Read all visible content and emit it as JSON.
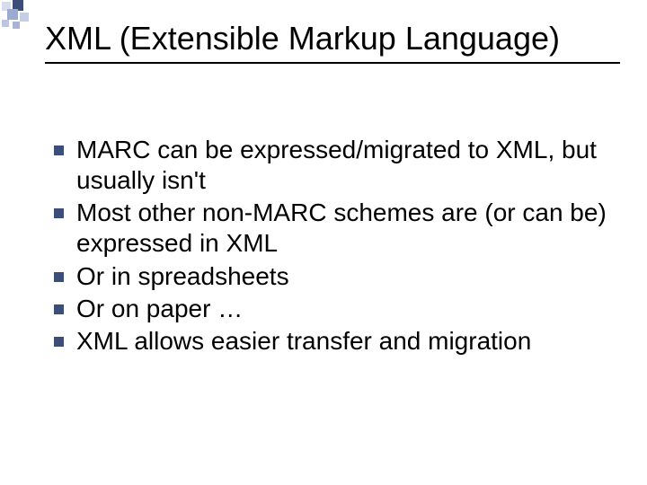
{
  "title": "XML (Extensible Markup Language)",
  "bullets": {
    "b0": "MARC can be expressed/migrated to XML, but usually isn't",
    "b1": "Most other non-MARC schemes are (or can be) expressed in XML",
    "b2": "Or in spreadsheets",
    "b3": "Or on paper …",
    "b4": "XML allows easier transfer and migration"
  }
}
